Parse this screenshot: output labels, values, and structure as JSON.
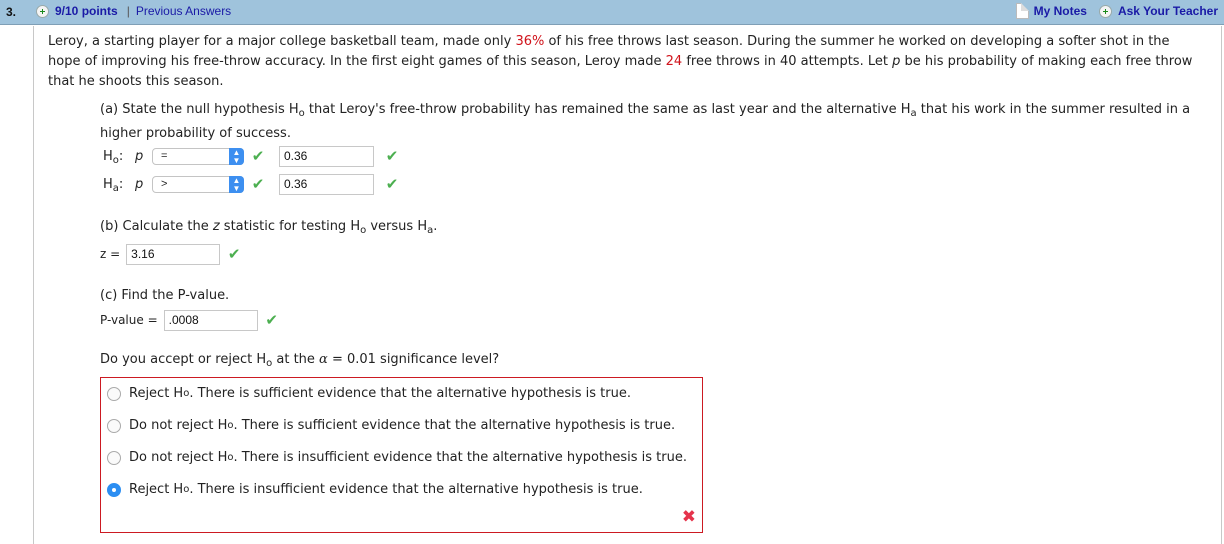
{
  "header": {
    "question_number": "3.",
    "points": "9/10 points",
    "separator": "|",
    "previous_answers": "Previous Answers",
    "my_notes": "My Notes",
    "ask_teacher": "Ask Your Teacher"
  },
  "problem": {
    "p1_a": "Leroy, a starting player for a major college basketball team, made only ",
    "p1_pct": "36%",
    "p1_b": " of his free throws last season. During the summer he worked on developing a softer shot in the",
    "p2_a": "hope of improving his free-throw accuracy. In the first eight games of this season, Leroy made ",
    "p2_made": "24",
    "p2_b": " free throws in 40 attempts. Let ",
    "p2_var": "p",
    "p2_c": " be his probability of making each free throw",
    "p3": "that he shoots this season."
  },
  "part_a": {
    "t1": "(a) State the null hypothesis H",
    "sub_o": "o",
    "t2": " that Leroy's free-throw probability has remained the same as last year and the alternative H",
    "sub_a": "a",
    "t3": " that his work in the summer resulted in a",
    "t4": "higher probability of success.",
    "h0": {
      "label": "H",
      "sub": "o",
      "colon": ":",
      "var": "p",
      "operator": "=",
      "value": "0.36"
    },
    "ha": {
      "label": "H",
      "sub": "a",
      "colon": ":",
      "var": "p",
      "operator": ">",
      "value": "0.36"
    },
    "select_arrow": "⌃⌄",
    "check": "✔"
  },
  "part_b": {
    "t1": "(b) Calculate the ",
    "var": "z",
    "t2": " statistic for testing H",
    "sub_o": "o",
    "t3": " versus H",
    "sub_a": "a",
    "t4": ".",
    "label": "z =",
    "value": "3.16"
  },
  "part_c": {
    "t1": "(c) Find the P-value.",
    "label": "P-value =",
    "value": ".0008"
  },
  "part_d": {
    "t1": "Do you accept or reject H",
    "sub_o": "o",
    "t2": " at the ",
    "alpha": "α",
    "t3": " = 0.01 significance level?",
    "choices": [
      {
        "a": "Reject H",
        "sub": "o",
        "b": ". There is sufficient evidence that the alternative hypothesis is true.",
        "selected": false
      },
      {
        "a": "Do not reject H",
        "sub": "o",
        "b": ". There is sufficient evidence that the alternative hypothesis is true.",
        "selected": false
      },
      {
        "a": "Do not reject H",
        "sub": "o",
        "b": ". There is insufficient evidence that the alternative hypothesis is true.",
        "selected": false
      },
      {
        "a": "Reject H",
        "sub": "o",
        "b": ". There is insufficient evidence that the alternative hypothesis is true.",
        "selected": true
      }
    ],
    "result_icon": "✖"
  },
  "colors": {
    "header_bg": "#9fc3dc",
    "link": "#1a1aa6",
    "highlight": "#d0131b",
    "correct": "#4caf50",
    "incorrect": "#e5334b"
  }
}
